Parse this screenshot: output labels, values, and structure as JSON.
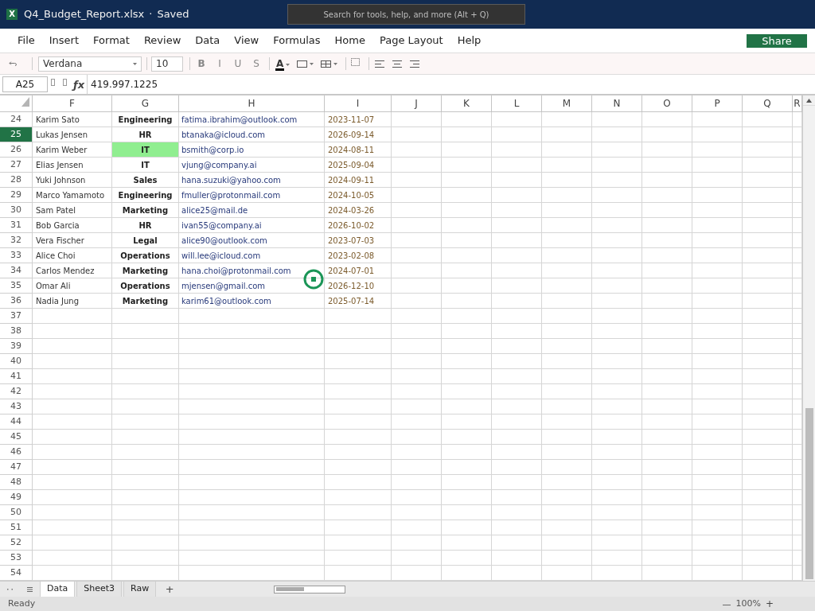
{
  "title_bar": {
    "logo": "X",
    "file_name": "Q4_Budget_Report.xlsx",
    "separator": "·",
    "save_status": "Saved",
    "search": {
      "placeholder": "Search for tools, help, and more (Alt + Q)"
    }
  },
  "menu": [
    "File",
    "Insert",
    "Format",
    "Review",
    "Data",
    "View",
    "Formulas",
    "Home",
    "Page Layout",
    "Help"
  ],
  "share_button": "Share",
  "toolbar": {
    "font": "Verdana",
    "font_size": "10",
    "format_buttons": [
      {
        "label": "B",
        "kind": "bold"
      },
      {
        "label": "I",
        "kind": "italic"
      },
      {
        "label": "U",
        "kind": "underline"
      },
      {
        "label": "S",
        "kind": "strikethrough"
      }
    ],
    "font_color_glyph": "A"
  },
  "formula_bar": {
    "name_box": "A25",
    "function_glyph": "ƒx",
    "value": "419.997.1225"
  },
  "grid": {
    "columns": [
      {
        "label": "F",
        "kind": "plain"
      },
      {
        "label": "G",
        "kind": "bold"
      },
      {
        "label": "H",
        "kind": "email"
      },
      {
        "label": "I",
        "kind": "date"
      },
      {
        "label": "J",
        "kind": "blank"
      },
      {
        "label": "K",
        "kind": "blank"
      },
      {
        "label": "L",
        "kind": "blank"
      },
      {
        "label": "M",
        "kind": "blank"
      },
      {
        "label": "N",
        "kind": "blank"
      },
      {
        "label": "O",
        "kind": "blank"
      },
      {
        "label": "P",
        "kind": "blank"
      },
      {
        "label": "Q",
        "kind": "blank"
      },
      {
        "label": "R",
        "kind": "blank"
      }
    ],
    "rows": [
      {
        "number": "24",
        "selected": false,
        "cells": [
          {
            "text": "Karim Sato"
          },
          {
            "text": "Engineering"
          },
          {
            "text": "fatima.ibrahim@outlook.com"
          },
          {
            "text": "2023-11-07"
          }
        ]
      },
      {
        "number": "25",
        "selected": true,
        "cells": [
          {
            "text": "Lukas Jensen"
          },
          {
            "text": "HR"
          },
          {
            "text": "btanaka@icloud.com"
          },
          {
            "text": "2026-09-14"
          }
        ]
      },
      {
        "number": "26",
        "selected": false,
        "cells": [
          {
            "text": "Karim Weber"
          },
          {
            "text": "IT",
            "color": "#90ee90"
          },
          {
            "text": "bsmith@corp.io"
          },
          {
            "text": "2024-08-11"
          }
        ]
      },
      {
        "number": "27",
        "selected": false,
        "cells": [
          {
            "text": "Elias Jensen"
          },
          {
            "text": "IT"
          },
          {
            "text": "vjung@company.ai"
          },
          {
            "text": "2025-09-04"
          }
        ]
      },
      {
        "number": "28",
        "selected": false,
        "cells": [
          {
            "text": "Yuki Johnson"
          },
          {
            "text": "Sales"
          },
          {
            "text": "hana.suzuki@yahoo.com"
          },
          {
            "text": "2024-09-11"
          }
        ]
      },
      {
        "number": "29",
        "selected": false,
        "cells": [
          {
            "text": "Marco Yamamoto"
          },
          {
            "text": "Engineering"
          },
          {
            "text": "fmuller@protonmail.com"
          },
          {
            "text": "2024-10-05"
          }
        ]
      },
      {
        "number": "30",
        "selected": false,
        "cells": [
          {
            "text": "Sam Patel"
          },
          {
            "text": "Marketing"
          },
          {
            "text": "alice25@mail.de"
          },
          {
            "text": "2024-03-26"
          }
        ]
      },
      {
        "number": "31",
        "selected": false,
        "cells": [
          {
            "text": "Bob Garcia"
          },
          {
            "text": "HR"
          },
          {
            "text": "ivan55@company.ai"
          },
          {
            "text": "2026-10-02"
          }
        ]
      },
      {
        "number": "32",
        "selected": false,
        "cells": [
          {
            "text": "Vera Fischer"
          },
          {
            "text": "Legal"
          },
          {
            "text": "alice90@outlook.com"
          },
          {
            "text": "2023-07-03"
          }
        ]
      },
      {
        "number": "33",
        "selected": false,
        "cells": [
          {
            "text": "Alice Choi"
          },
          {
            "text": "Operations"
          },
          {
            "text": "will.lee@icloud.com"
          },
          {
            "text": "2023-02-08"
          }
        ]
      },
      {
        "number": "34",
        "selected": false,
        "cells": [
          {
            "text": "Carlos Mendez"
          },
          {
            "text": "Marketing"
          },
          {
            "text": "hana.choi@protonmail.com"
          },
          {
            "text": "2024-07-01"
          }
        ]
      },
      {
        "number": "35",
        "selected": false,
        "cells": [
          {
            "text": "Omar Ali"
          },
          {
            "text": "Operations"
          },
          {
            "text": "mjensen@gmail.com"
          },
          {
            "text": "2026-12-10"
          }
        ]
      },
      {
        "number": "36",
        "selected": false,
        "cells": [
          {
            "text": "Nadia Jung"
          },
          {
            "text": "Marketing"
          },
          {
            "text": "karim61@outlook.com"
          },
          {
            "text": "2025-07-14"
          }
        ]
      },
      {
        "number": "37",
        "selected": false
      },
      {
        "number": "38",
        "selected": false
      },
      {
        "number": "39",
        "selected": false
      },
      {
        "number": "40",
        "selected": false
      },
      {
        "number": "41",
        "selected": false
      },
      {
        "number": "42",
        "selected": false
      },
      {
        "number": "43",
        "selected": false
      },
      {
        "number": "44",
        "selected": false
      },
      {
        "number": "45",
        "selected": false
      },
      {
        "number": "46",
        "selected": false
      },
      {
        "number": "47",
        "selected": false
      },
      {
        "number": "48",
        "selected": false
      },
      {
        "number": "49",
        "selected": false
      },
      {
        "number": "50",
        "selected": false
      },
      {
        "number": "51",
        "selected": false
      },
      {
        "number": "52",
        "selected": false
      },
      {
        "number": "53",
        "selected": false
      },
      {
        "number": "54",
        "selected": false
      }
    ]
  },
  "sheet_tabs": [
    {
      "label": "Data",
      "selected": true
    },
    {
      "label": "Sheet3",
      "selected": false
    },
    {
      "label": "Raw",
      "selected": false
    }
  ],
  "add_sheet": "+",
  "status_bar": {
    "status": "Ready",
    "zoom_out": "—",
    "zoom": "100%",
    "zoom_in": "+"
  }
}
